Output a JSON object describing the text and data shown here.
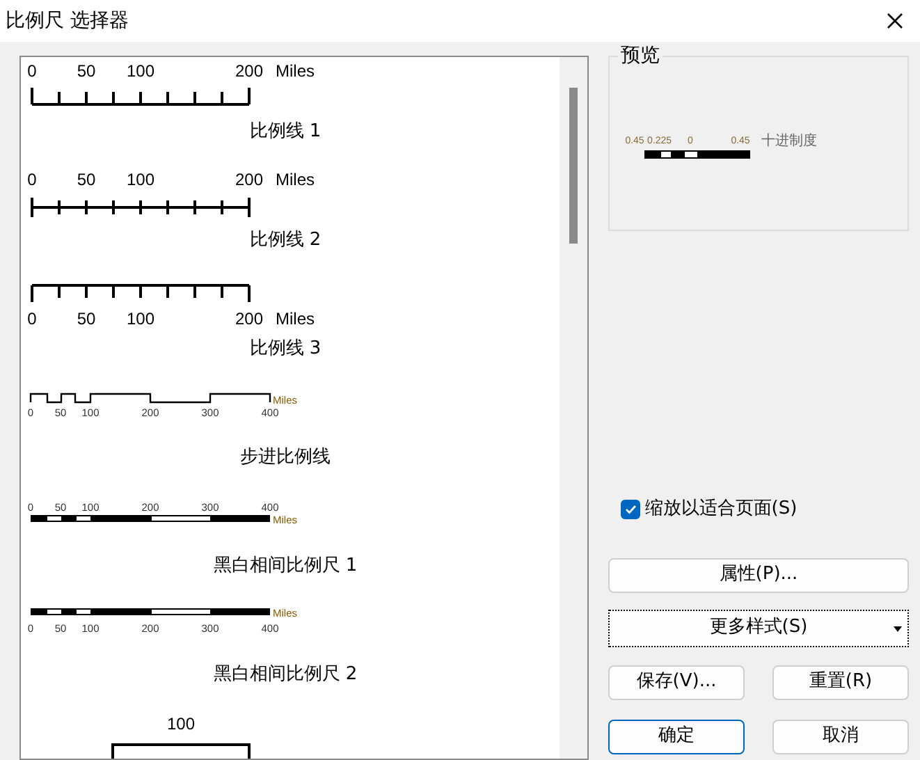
{
  "window": {
    "title": "比例尺 选择器"
  },
  "scales": [
    {
      "kind": "ticks-up",
      "ticks": [
        "0",
        "50",
        "100",
        "200"
      ],
      "unit": "Miles",
      "name": "比例线 1"
    },
    {
      "kind": "ticks-cross",
      "ticks": [
        "0",
        "50",
        "100",
        "200"
      ],
      "unit": "Miles",
      "name": "比例线 2"
    },
    {
      "kind": "ticks-down",
      "ticks": [
        "0",
        "50",
        "100",
        "200"
      ],
      "unit": "Miles",
      "name": "比例线 3"
    },
    {
      "kind": "step",
      "ticks": [
        "0",
        "50",
        "100",
        "200",
        "300",
        "400"
      ],
      "unit": "Miles",
      "name": "步进比例线"
    },
    {
      "kind": "alt-top",
      "ticks": [
        "0",
        "50",
        "100",
        "200",
        "300",
        "400"
      ],
      "unit": "Miles",
      "name": "黑白相间比例尺 1"
    },
    {
      "kind": "alt-bottom",
      "ticks": [
        "0",
        "50",
        "100",
        "200",
        "300",
        "400"
      ],
      "unit": "Miles",
      "name": "黑白相间比例尺 2"
    },
    {
      "kind": "bracket",
      "ticks": [
        "100"
      ]
    }
  ],
  "preview": {
    "label": "预览",
    "ticks": [
      "0.45",
      "0.225",
      "0",
      "0.45"
    ],
    "unit": "十进制度"
  },
  "checkbox": {
    "label": "缩放以适合页面(S)",
    "checked": true
  },
  "buttons": [
    {
      "kind": "wide",
      "label": "属性(P)...",
      "default": false
    },
    {
      "kind": "dropdown",
      "label": "更多样式(S)",
      "default": false
    },
    {
      "kind": "pair",
      "label": "保存(V)...",
      "default": false
    },
    {
      "kind": "pair",
      "label": "重置(R)",
      "default": false
    },
    {
      "kind": "pair",
      "label": "确定",
      "default": true
    },
    {
      "kind": "pair",
      "label": "取消",
      "default": false
    }
  ]
}
